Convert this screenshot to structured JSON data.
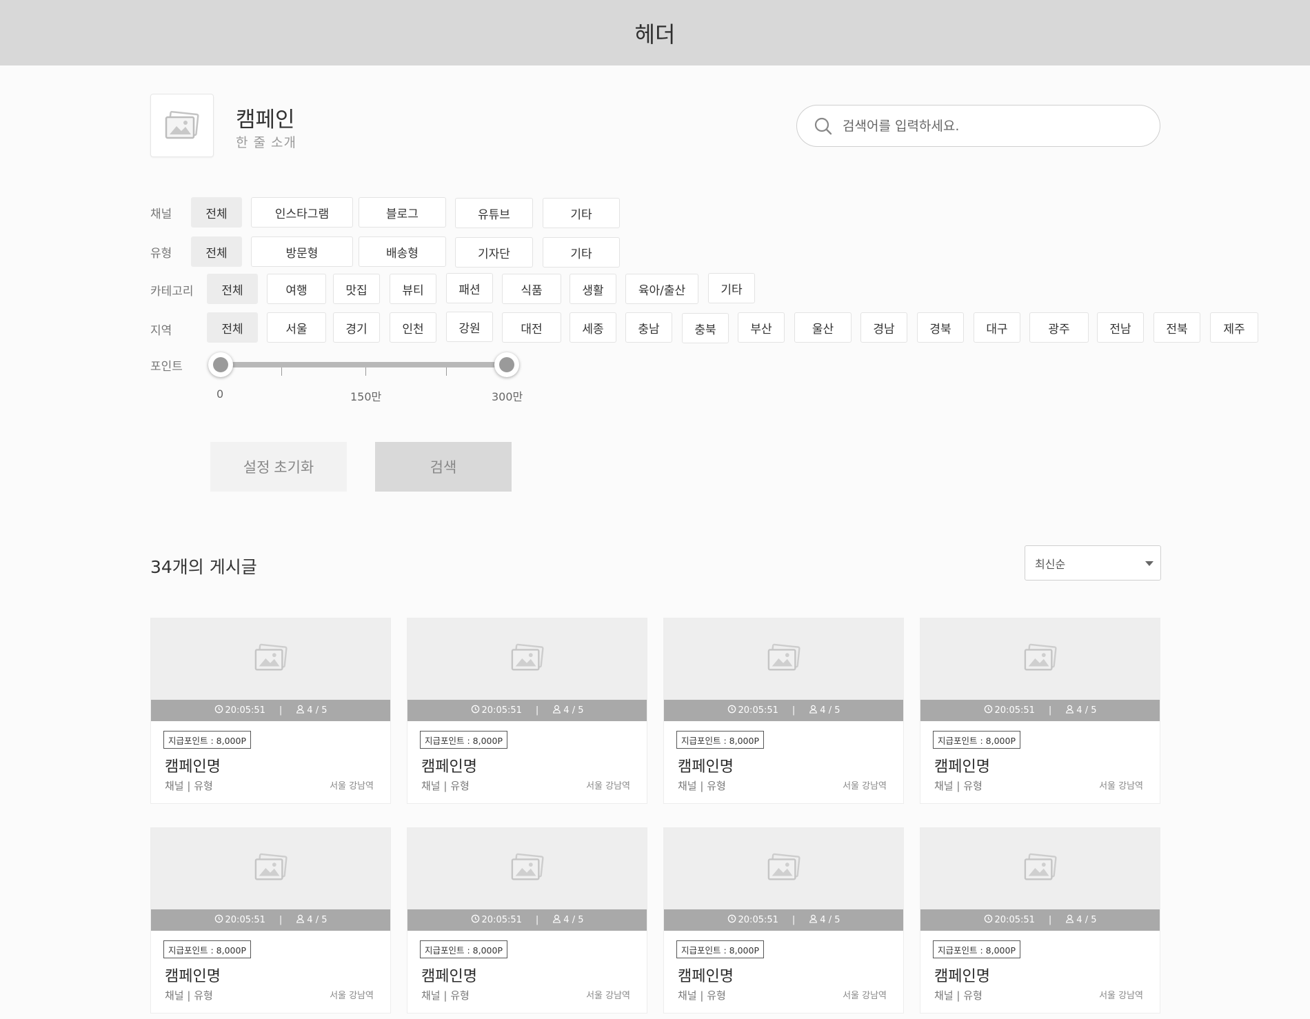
{
  "header": {
    "title": "헤더"
  },
  "campaign": {
    "title": "캠페인",
    "subtitle": "한 줄 소개"
  },
  "search": {
    "placeholder": "검색어를 입력하세요."
  },
  "filters": {
    "channel": {
      "label": "채널",
      "options": [
        "전체",
        "인스타그램",
        "블로그",
        "유튜브",
        "기타"
      ],
      "selected": "전체"
    },
    "type": {
      "label": "유형",
      "options": [
        "전체",
        "방문형",
        "배송형",
        "기자단",
        "기타"
      ],
      "selected": "전체"
    },
    "category": {
      "label": "카테고리",
      "options": [
        "전체",
        "여행",
        "맛집",
        "뷰티",
        "패션",
        "식품",
        "생활",
        "육아/출산",
        "기타"
      ],
      "selected": "전체"
    },
    "region": {
      "label": "지역",
      "options": [
        "전체",
        "서울",
        "경기",
        "인천",
        "강원",
        "대전",
        "세종",
        "충남",
        "충북",
        "부산",
        "울산",
        "경남",
        "경북",
        "대구",
        "광주",
        "전남",
        "전북",
        "제주"
      ],
      "selected": "전체"
    },
    "point": {
      "label": "포인트",
      "ticks": [
        "0",
        "150만",
        "300만"
      ],
      "range_min_fraction": 0.0,
      "range_max_fraction": 1.0
    }
  },
  "actions": {
    "reset_label": "설정 초기화",
    "search_label": "검색"
  },
  "results": {
    "count_title": "34개의 게시글",
    "sort_selected": "최신순"
  },
  "cards": [
    {
      "time": "20:05:51",
      "people": "4 / 5",
      "points": "지급포인트 : 8,000P",
      "name": "캠페인명",
      "meta": "채널 | 유형",
      "location": "서울 강남역"
    },
    {
      "time": "20:05:51",
      "people": "4 / 5",
      "points": "지급포인트 : 8,000P",
      "name": "캠페인명",
      "meta": "채널 | 유형",
      "location": "서울 강남역"
    },
    {
      "time": "20:05:51",
      "people": "4 / 5",
      "points": "지급포인트 : 8,000P",
      "name": "캠페인명",
      "meta": "채널 | 유형",
      "location": "서울 강남역"
    },
    {
      "time": "20:05:51",
      "people": "4 / 5",
      "points": "지급포인트 : 8,000P",
      "name": "캠페인명",
      "meta": "채널 | 유형",
      "location": "서울 강남역"
    },
    {
      "time": "20:05:51",
      "people": "4 / 5",
      "points": "지급포인트 : 8,000P",
      "name": "캠페인명",
      "meta": "채널 | 유형",
      "location": "서울 강남역"
    },
    {
      "time": "20:05:51",
      "people": "4 / 5",
      "points": "지급포인트 : 8,000P",
      "name": "캠페인명",
      "meta": "채널 | 유형",
      "location": "서울 강남역"
    },
    {
      "time": "20:05:51",
      "people": "4 / 5",
      "points": "지급포인트 : 8,000P",
      "name": "캠페인명",
      "meta": "채널 | 유형",
      "location": "서울 강남역"
    },
    {
      "time": "20:05:51",
      "people": "4 / 5",
      "points": "지급포인트 : 8,000P",
      "name": "캠페인명",
      "meta": "채널 | 유형",
      "location": "서울 강남역"
    }
  ],
  "colors": {
    "header_bg": "#d8d8d8",
    "chip_active_bg": "#ececec",
    "card_bar_bg": "#a9a9a9"
  }
}
